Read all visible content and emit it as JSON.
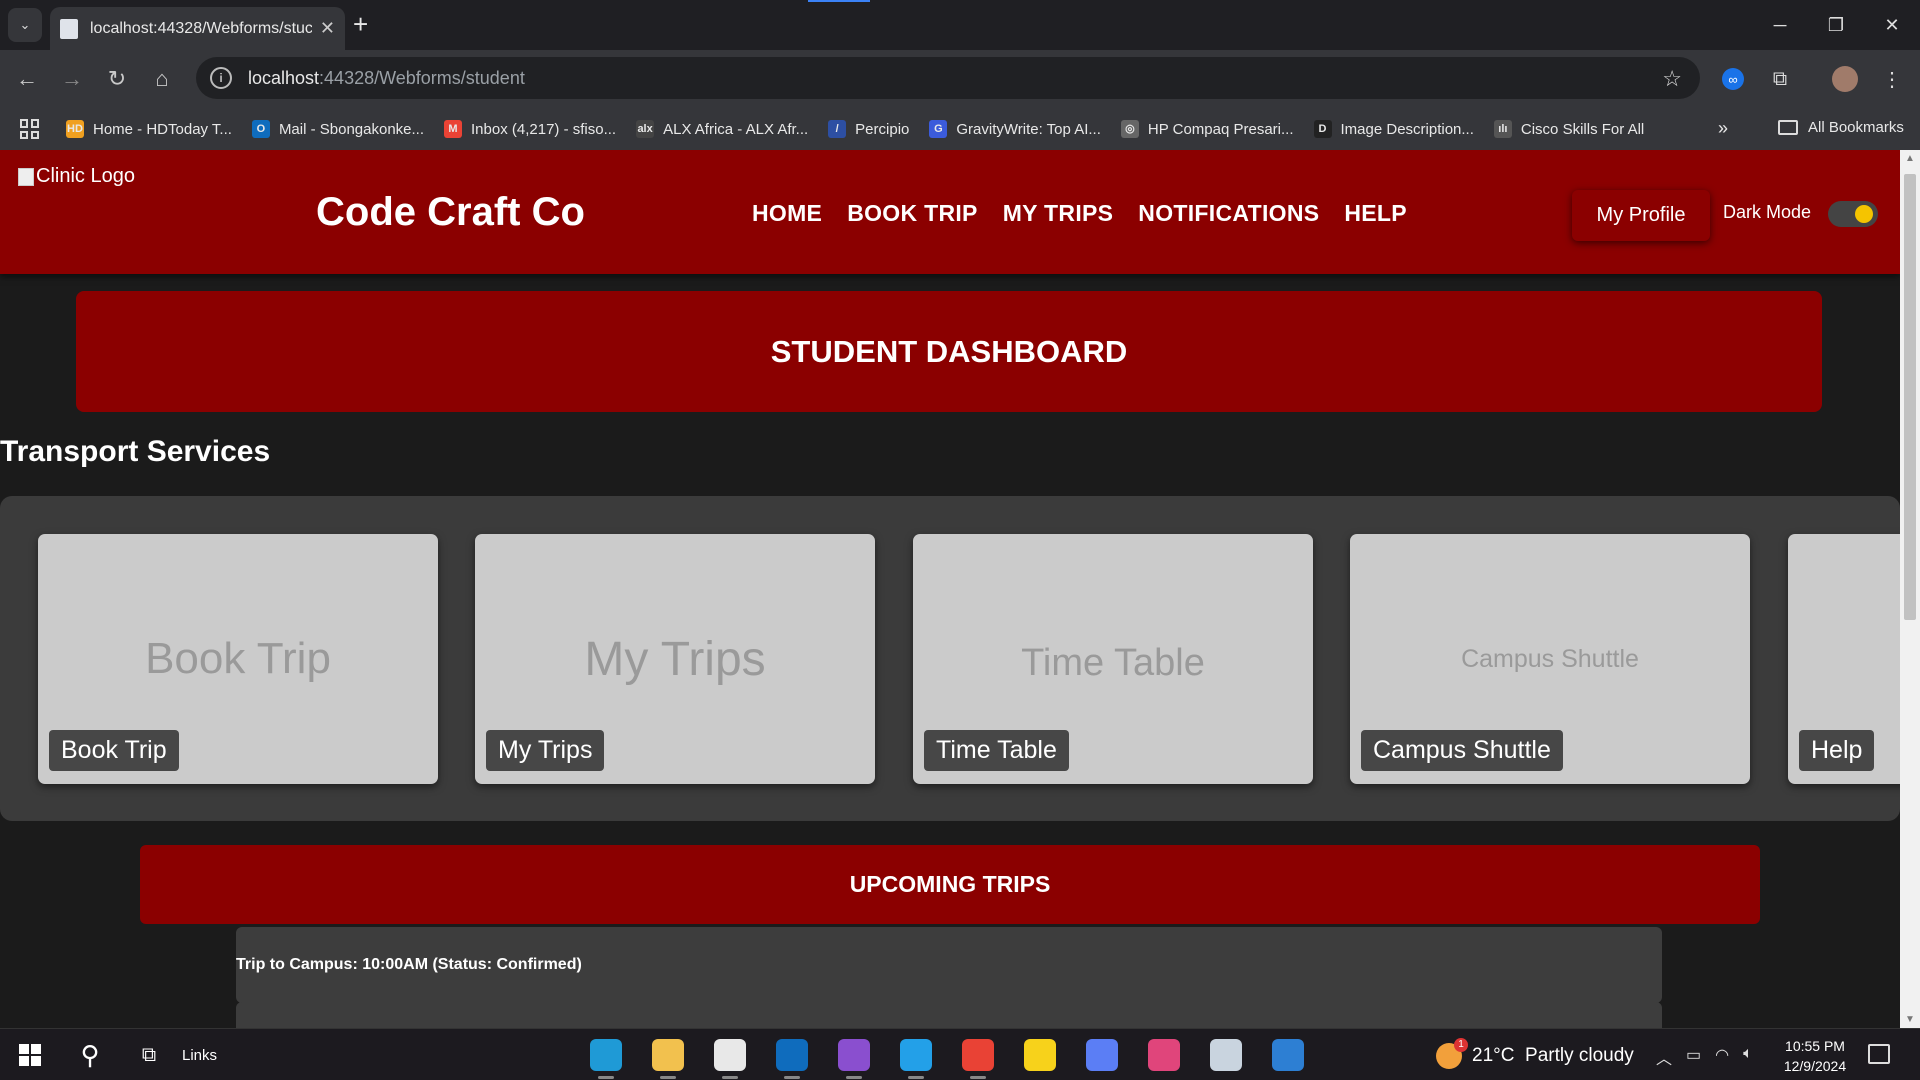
{
  "browser": {
    "tab_title": "localhost:44328/Webforms/stuc",
    "url_host": "localhost",
    "url_path": ":44328/Webforms/student",
    "bookmarks": [
      {
        "label": "Home - HDToday T...",
        "icon_text": "HD",
        "color": "#f0a020"
      },
      {
        "label": "Mail - Sbongakonke...",
        "icon_text": "O",
        "color": "#0f6cbd"
      },
      {
        "label": "Inbox (4,217) - sfiso...",
        "icon_text": "M",
        "color": "#ea4335"
      },
      {
        "label": "ALX Africa - ALX Afr...",
        "icon_text": "alx",
        "color": "#444"
      },
      {
        "label": "Percipio",
        "icon_text": "/",
        "color": "#2d4fa3"
      },
      {
        "label": "GravityWrite: Top AI...",
        "icon_text": "G",
        "color": "#3b5bdb"
      },
      {
        "label": "HP Compaq Presari...",
        "icon_text": "◎",
        "color": "#666"
      },
      {
        "label": "Image Description...",
        "icon_text": "D",
        "color": "#222"
      },
      {
        "label": "Cisco Skills For All",
        "icon_text": "ılı",
        "color": "#555"
      }
    ],
    "all_bookmarks": "All Bookmarks"
  },
  "site": {
    "logo_alt": "Clinic Logo",
    "brand": "Code Craft Co",
    "nav": [
      "HOME",
      "BOOK TRIP",
      "MY TRIPS",
      "NOTIFICATIONS",
      "HELP"
    ],
    "profile_label": "My Profile",
    "dark_mode_label": "Dark Mode",
    "dark_mode_on": true
  },
  "dashboard": {
    "title": "STUDENT DASHBOARD",
    "section_title": "Transport Services",
    "cards": [
      {
        "placeholder": "Book Trip",
        "caption": "Book Trip"
      },
      {
        "placeholder": "My Trips",
        "caption": "My Trips"
      },
      {
        "placeholder": "Time Table",
        "caption": "Time Table"
      },
      {
        "placeholder": "Campus Shuttle",
        "caption": "Campus Shuttle"
      },
      {
        "placeholder": "",
        "caption": "Help"
      }
    ],
    "upcoming_title": "UPCOMING TRIPS",
    "trips": [
      "Trip to Campus: 10:00AM (Status: Confirmed)",
      ""
    ]
  },
  "taskbar": {
    "links_label": "Links",
    "weather_temp": "21°C",
    "weather_desc": "Partly cloudy",
    "weather_badge": "1",
    "time": "10:55 PM",
    "date": "12/9/2024",
    "apps": [
      {
        "name": "edge-icon",
        "color": "#1f9ad6"
      },
      {
        "name": "file-explorer-icon",
        "color": "#f2c14e"
      },
      {
        "name": "microsoft-store-icon",
        "color": "#e8e8e8"
      },
      {
        "name": "outlook-icon",
        "color": "#0f6cbd"
      },
      {
        "name": "visual-studio-icon",
        "color": "#8a4fcf"
      },
      {
        "name": "vscode-icon",
        "color": "#23a0e8"
      },
      {
        "name": "chrome-icon",
        "color": "#e94235"
      },
      {
        "name": "sticky-notes-icon",
        "color": "#f7d21b"
      },
      {
        "name": "paint-icon",
        "color": "#5b7ef5"
      },
      {
        "name": "snipping-tool-icon",
        "color": "#e0457b"
      },
      {
        "name": "printer-app-icon",
        "color": "#c9d4df"
      },
      {
        "name": "photos-icon",
        "color": "#2d7fd3"
      }
    ]
  }
}
